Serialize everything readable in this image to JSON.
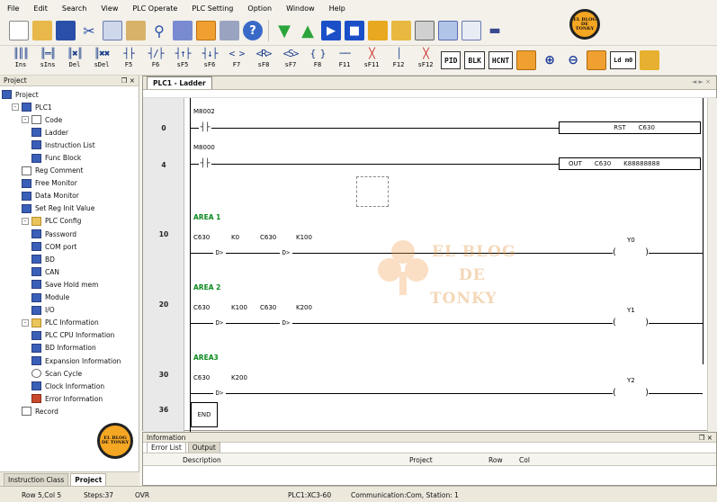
{
  "menu": [
    "File",
    "Edit",
    "Search",
    "View",
    "PLC Operate",
    "PLC Setting",
    "Option",
    "Window",
    "Help"
  ],
  "toolbar2": {
    "fkeys": [
      {
        "sym": "║║║",
        "label": "Ins"
      },
      {
        "sym": "║═║",
        "label": "sIns"
      },
      {
        "sym": "║✖║",
        "label": "Del"
      },
      {
        "sym": "║✖✖",
        "label": "sDel"
      },
      {
        "sym": "┤├",
        "label": "F5"
      },
      {
        "sym": "┤/├",
        "label": "F6"
      },
      {
        "sym": "┤↑├",
        "label": "sF5"
      },
      {
        "sym": "┤↓├",
        "label": "sF6"
      },
      {
        "sym": "< >",
        "label": "F7"
      },
      {
        "sym": "<R>",
        "label": "sF8"
      },
      {
        "sym": "<S>",
        "label": "sF7"
      },
      {
        "sym": "{ }",
        "label": "F8"
      },
      {
        "sym": "──",
        "label": "F11"
      },
      {
        "sym": "╳",
        "label": "sF11"
      },
      {
        "sym": "│",
        "label": "F12"
      },
      {
        "sym": "╳",
        "label": "sF12"
      }
    ],
    "pid": "PID",
    "blk": "BLK",
    "hcnt": "HCNT",
    "ld": "Ld m0"
  },
  "project_panel": {
    "title": "Project",
    "pin": "❐ ×",
    "tree": [
      {
        "level": 0,
        "label": "Project",
        "icon": "project",
        "exp": ""
      },
      {
        "level": 1,
        "label": "PLC1",
        "icon": "plc",
        "exp": "-"
      },
      {
        "level": 2,
        "label": "Code",
        "icon": "doc",
        "exp": "-"
      },
      {
        "level": 3,
        "label": "Ladder",
        "icon": "ladder",
        "exp": ""
      },
      {
        "level": 3,
        "label": "Instruction List",
        "icon": "il",
        "exp": ""
      },
      {
        "level": 3,
        "label": "Func Block",
        "icon": "fb",
        "exp": ""
      },
      {
        "level": 2,
        "label": "Reg Comment",
        "icon": "doc",
        "exp": ""
      },
      {
        "level": 2,
        "label": "Free Monitor",
        "icon": "monitor",
        "exp": ""
      },
      {
        "level": 2,
        "label": "Data Monitor",
        "icon": "monitor",
        "exp": ""
      },
      {
        "level": 2,
        "label": "Set Reg Init Value",
        "icon": "monitor",
        "exp": ""
      },
      {
        "level": 2,
        "label": "PLC Config",
        "icon": "folder",
        "exp": "-"
      },
      {
        "level": 3,
        "label": "Password",
        "icon": "password",
        "exp": ""
      },
      {
        "level": 3,
        "label": "COM port",
        "icon": "com",
        "exp": ""
      },
      {
        "level": 3,
        "label": "BD",
        "icon": "bd",
        "exp": ""
      },
      {
        "level": 3,
        "label": "CAN",
        "icon": "can",
        "exp": ""
      },
      {
        "level": 3,
        "label": "Save Hold mem",
        "icon": "save",
        "exp": ""
      },
      {
        "level": 3,
        "label": "Module",
        "icon": "module",
        "exp": ""
      },
      {
        "level": 3,
        "label": "I/O",
        "icon": "io",
        "exp": ""
      },
      {
        "level": 2,
        "label": "PLC Information",
        "icon": "folder",
        "exp": "-"
      },
      {
        "level": 3,
        "label": "PLC CPU Information",
        "icon": "cpu",
        "exp": ""
      },
      {
        "level": 3,
        "label": "BD Information",
        "icon": "bdinfo",
        "exp": ""
      },
      {
        "level": 3,
        "label": "Expansion Information",
        "icon": "exp",
        "exp": ""
      },
      {
        "level": 3,
        "label": "Scan Cycle",
        "icon": "cycle",
        "exp": ""
      },
      {
        "level": 3,
        "label": "Clock Information",
        "icon": "clock",
        "exp": ""
      },
      {
        "level": 3,
        "label": "Error Information",
        "icon": "error",
        "exp": ""
      },
      {
        "level": 2,
        "label": "Record",
        "icon": "record",
        "exp": ""
      }
    ],
    "bottom_tabs": [
      "Instruction Class",
      "Project"
    ]
  },
  "editor": {
    "tab": "PLC1 - Ladder",
    "ctrl": "◄ ► ×",
    "steps": [
      "0",
      "4",
      "10",
      "20",
      "30",
      "36"
    ],
    "rung0": {
      "contact": "M8002",
      "inst": [
        "RST",
        "C630"
      ]
    },
    "rung4": {
      "contact": "M8000",
      "inst": [
        "OUT",
        "C630",
        "K88888888"
      ]
    },
    "area1": {
      "label": "AREA 1",
      "c1": "C630",
      "c1v": "K0",
      "c2": "C630",
      "c2v": "K100",
      "coil": "Y0"
    },
    "area2": {
      "label": "AREA 2",
      "c1": "C630",
      "c1v": "K100",
      "c2": "C630",
      "c2v": "K200",
      "coil": "Y1"
    },
    "area3": {
      "label": "AREA3",
      "c1": "C630",
      "c1v": "K200",
      "coil": "Y2"
    },
    "end": "END",
    "contact_sym": "┤├",
    "cmp_sym": "D>",
    "coil_l": "(",
    "coil_r": ")"
  },
  "info_panel": {
    "title": "Information",
    "pin": "❐ ×",
    "tabs": [
      "Error List",
      "Output"
    ],
    "columns": [
      "Description",
      "Project",
      "Row",
      "Col"
    ]
  },
  "status": {
    "pos": "Row 5,Col 5",
    "steps": "Steps:37",
    "mode": "OVR",
    "plc": "PLC1:XC3-60",
    "comm": "Communication:Com, Station: 1"
  },
  "watermark": {
    "line1": "EL BLOG",
    "line2": "DE",
    "line3": "TONKY"
  },
  "badge_text": "EL BLOG DE TONKY"
}
